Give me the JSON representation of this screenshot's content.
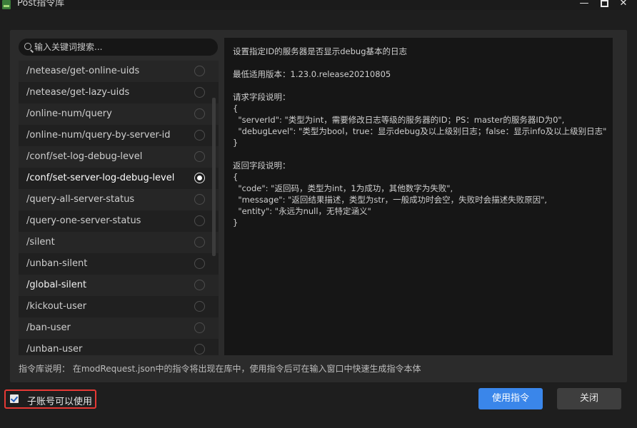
{
  "window": {
    "title": "Post指令库",
    "minimize": "—",
    "close": "✕"
  },
  "search": {
    "placeholder": "输入关键词搜索..."
  },
  "commands": [
    "/netease/get-online-uids",
    "/netease/get-lazy-uids",
    "/online-num/query",
    "/online-num/query-by-server-id",
    "/conf/set-log-debug-level",
    "/conf/set-server-log-debug-level",
    "/query-all-server-status",
    "/query-one-server-status",
    "/silent",
    "/unban-silent",
    "/global-silent",
    "/kickout-user",
    "/ban-user",
    "/unban-user"
  ],
  "selected_index": 5,
  "detail": {
    "text": "设置指定ID的服务器是否显示debug基本的日志\n\n最低适用版本：1.23.0.release20210805\n\n请求字段说明：\n{\n  \"serverId\": \"类型为int，需要修改日志等级的服务器的ID；PS：master的服务器ID为0\",\n  \"debugLevel\": \"类型为bool，true：显示debug及以上级别日志；false：显示info及以上级别日志\"\n}\n\n返回字段说明：\n{\n  \"code\": \"返回码，类型为int，1为成功，其他数字为失败\",\n  \"message\": \"返回结果描述，类型为str，一般成功时会空，失败时会描述失败原因\",\n  \"entity\": \"永远为null，无特定涵义\"\n}"
  },
  "footer": {
    "help_text": "指令库说明：  在modRequest.json中的指令将出现在库中，使用指令后可在输入窗口中快速生成指令本体",
    "sub_account_label": "子账号可以使用",
    "use_button": "使用指令",
    "close_button": "关闭"
  }
}
